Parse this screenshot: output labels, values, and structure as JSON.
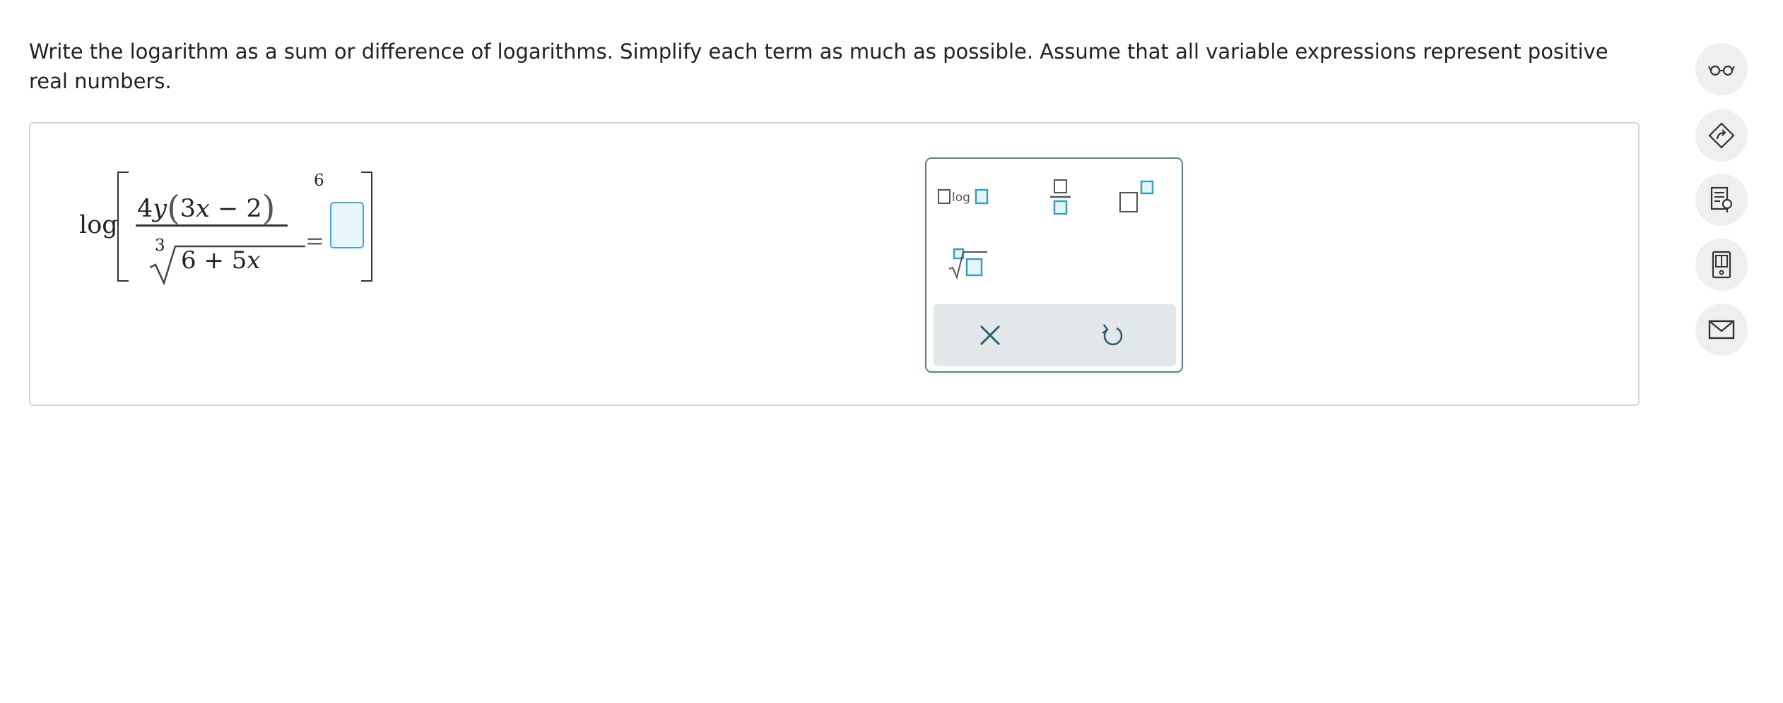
{
  "instructions": "Write the logarithm as a sum or difference of logarithms. Simplify each term as much as possible. Assume that all variable expressions represent positive real numbers.",
  "expression": {
    "log": "log",
    "numer_coef": "4",
    "numer_var": "y",
    "inner": "3x − 2",
    "inner_coef": "3",
    "inner_var": "x",
    "inner_rest": " − 2",
    "exponent": "6",
    "root_index": "3",
    "radicand_const": "6 + 5",
    "radicand_var": "x",
    "equals": "="
  },
  "palette": {
    "log_label": "log",
    "buttons": [
      "log-base",
      "fraction",
      "superscript",
      "nth-root"
    ],
    "actions": [
      "clear",
      "undo"
    ]
  },
  "side_tools": [
    "glasses-icon",
    "tutor-icon",
    "guide-icon",
    "calculator-icon",
    "mail-icon"
  ],
  "colors": {
    "accent": "#4ba8c5",
    "palette_border": "#5f7f8c",
    "action_bar": "#e2e7ea"
  }
}
